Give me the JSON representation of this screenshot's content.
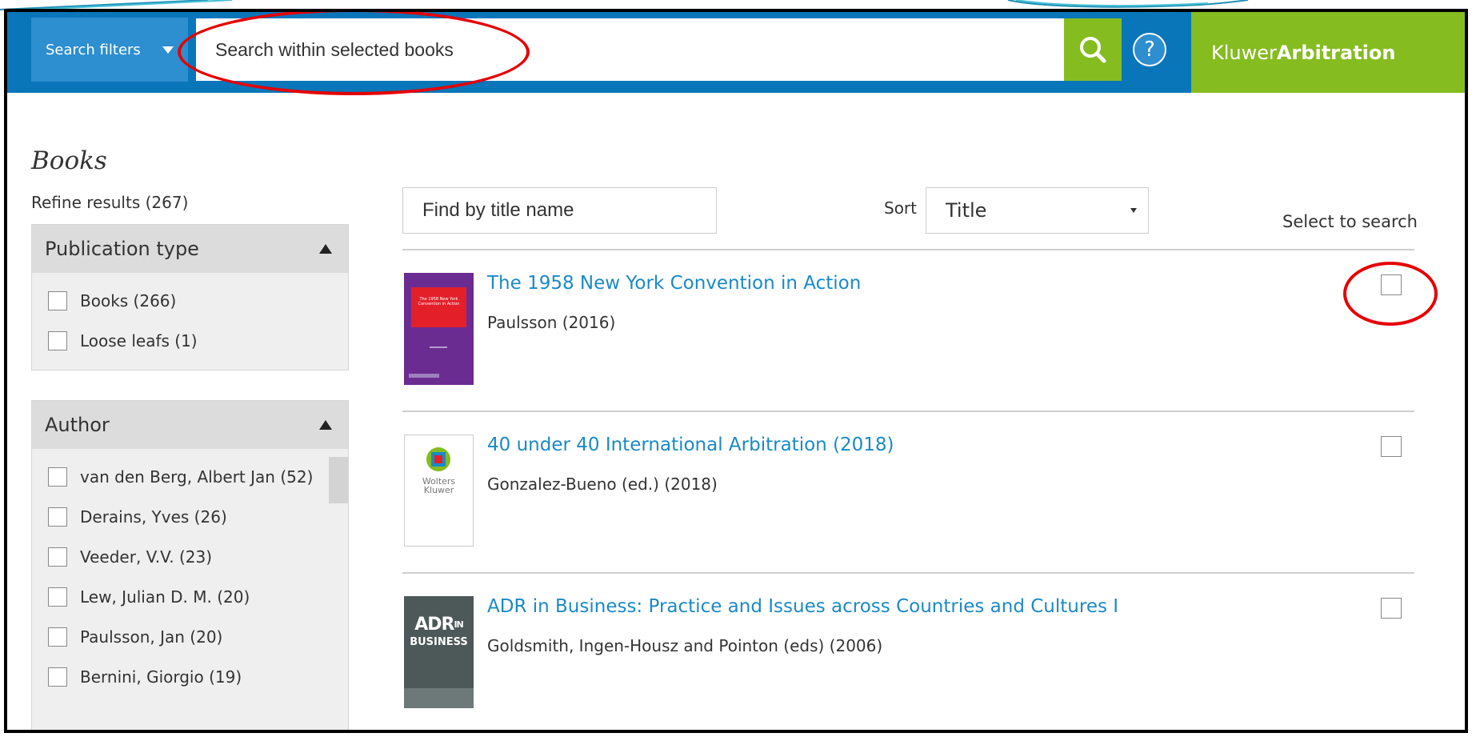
{
  "header": {
    "filters_label": "Search filters",
    "search_placeholder": "Search within selected books",
    "help_label": "?",
    "brand_light": "Kluwer",
    "brand_bold": "Arbitration"
  },
  "sidebar": {
    "title": "Books",
    "refine_label": "Refine results (267)",
    "facets": [
      {
        "label": "Publication type",
        "items": [
          {
            "label": "Books (266)"
          },
          {
            "label": "Loose leafs (1)"
          }
        ]
      },
      {
        "label": "Author",
        "items": [
          {
            "label": "van den Berg, Albert Jan (52)"
          },
          {
            "label": "Derains, Yves (26)"
          },
          {
            "label": "Veeder, V.V. (23)"
          },
          {
            "label": "Lew, Julian D. M. (20)"
          },
          {
            "label": "Paulsson, Jan (20)"
          },
          {
            "label": "Bernini, Giorgio (19)"
          }
        ]
      }
    ]
  },
  "main": {
    "find_placeholder": "Find by title name",
    "sort_label": "Sort",
    "sort_value": "Title",
    "select_label": "Select to search",
    "results": [
      {
        "title": "The 1958 New York Convention in Action",
        "author": "Paulsson (2016)",
        "cover_text": "The 1958 New York Convention in Action"
      },
      {
        "title": "40 under 40 International Arbitration (2018)",
        "author": "Gonzalez-Bueno (ed.) (2018)",
        "cover_text_1": "Wolters",
        "cover_text_2": "Kluwer"
      },
      {
        "title": "ADR in Business: Practice and Issues across Countries and Cultures I",
        "author": "Goldsmith, Ingen-Housz and Pointon (eds) (2006)",
        "cover_text_1": "ADR",
        "cover_text_2": "IN",
        "cover_text_3": "BUSINESS"
      }
    ]
  },
  "colors": {
    "header_blue": "#0a76ba",
    "brand_green": "#85bc20",
    "link_blue": "#1a8ac6",
    "annotation_red": "#e60000"
  },
  "icons": {
    "search": "search-icon",
    "help": "help-icon",
    "collapse": "triangle-up-icon",
    "dropdown": "caret-down-icon"
  }
}
